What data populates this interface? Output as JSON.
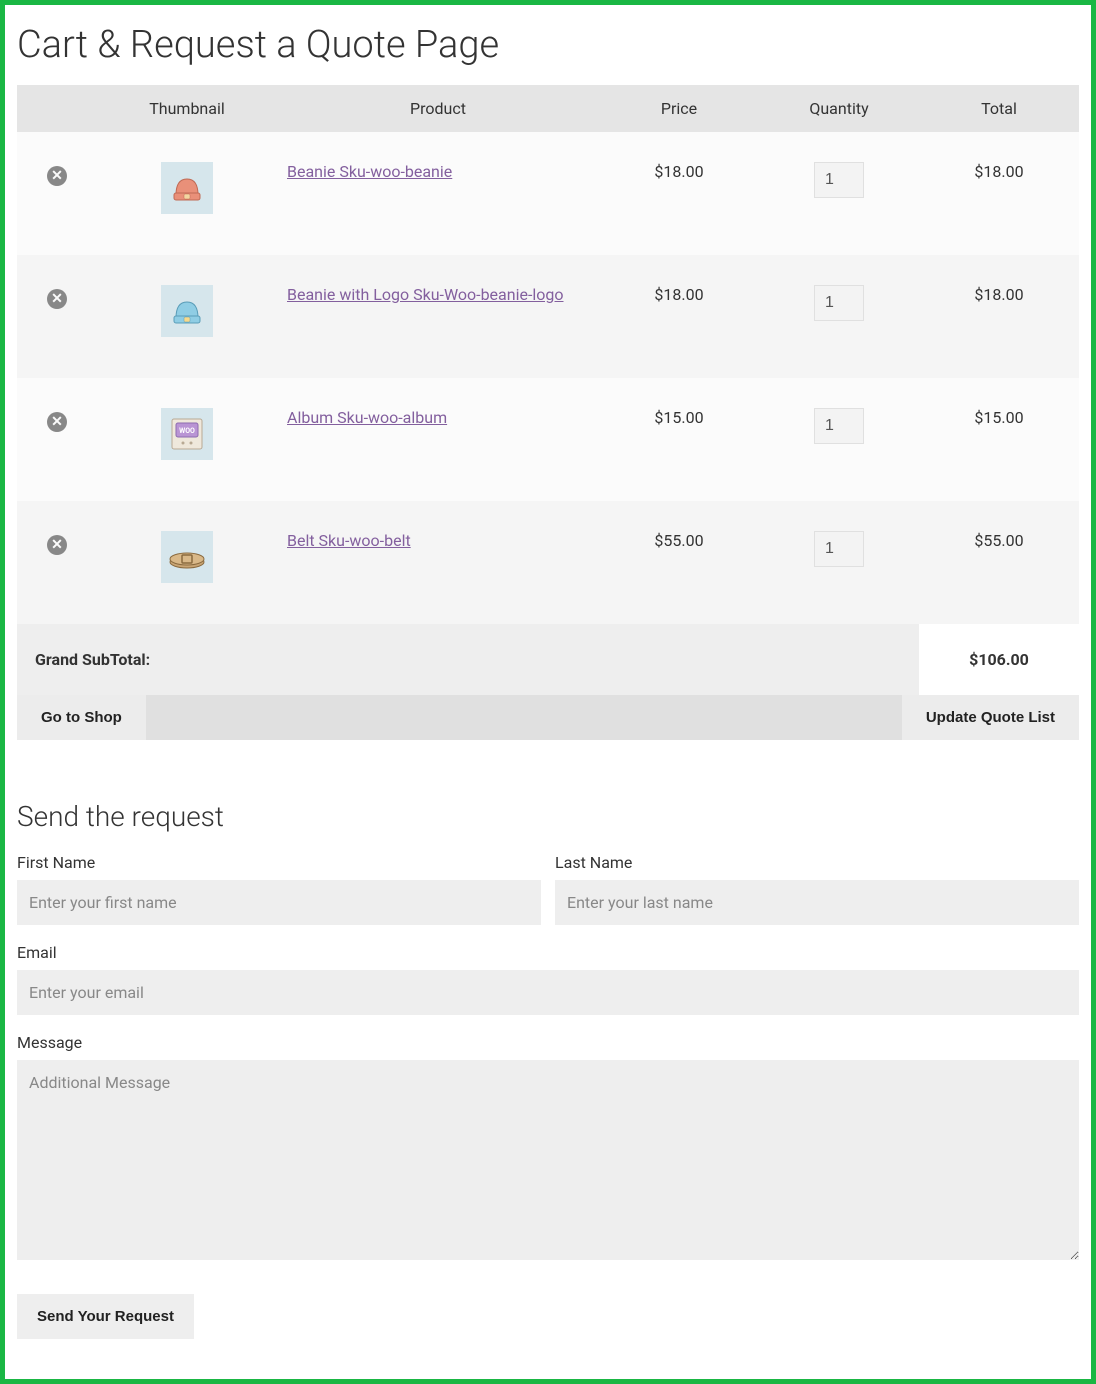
{
  "page": {
    "title": "Cart & Request a Quote Page"
  },
  "table": {
    "headers": {
      "thumbnail": "Thumbnail",
      "product": "Product",
      "price": "Price",
      "quantity": "Quantity",
      "total": "Total"
    },
    "rows": [
      {
        "icon": "beanie-red",
        "product": "Beanie Sku-woo-beanie",
        "price": "$18.00",
        "quantity": "1",
        "total": "$18.00"
      },
      {
        "icon": "beanie-blue",
        "product": "Beanie with Logo Sku-Woo-beanie-logo",
        "price": "$18.00",
        "quantity": "1",
        "total": "$18.00"
      },
      {
        "icon": "album",
        "product": "Album Sku-woo-album",
        "price": "$15.00",
        "quantity": "1",
        "total": "$15.00"
      },
      {
        "icon": "belt",
        "product": "Belt Sku-woo-belt",
        "price": "$55.00",
        "quantity": "1",
        "total": "$55.00"
      }
    ],
    "subtotal_label": "Grand SubTotal:",
    "subtotal_value": "$106.00"
  },
  "actions": {
    "go_to_shop": "Go to Shop",
    "update_quote": "Update Quote List"
  },
  "form": {
    "title": "Send the request",
    "first_name_label": "First Name",
    "first_name_placeholder": "Enter your first name",
    "last_name_label": "Last Name",
    "last_name_placeholder": "Enter your last name",
    "email_label": "Email",
    "email_placeholder": "Enter your email",
    "message_label": "Message",
    "message_placeholder": "Additional Message",
    "send_button": "Send Your Request"
  }
}
